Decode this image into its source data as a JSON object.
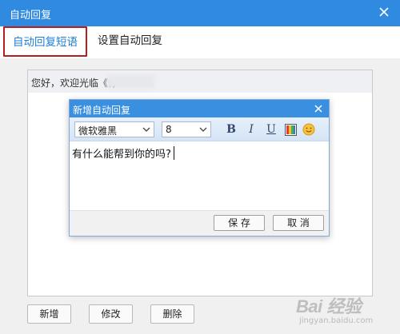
{
  "window": {
    "title": "自动回复"
  },
  "tabs": [
    {
      "label": "自动回复短语",
      "active": true
    },
    {
      "label": "设置自动回复",
      "active": false
    }
  ],
  "list": {
    "items": [
      {
        "text": "您好，欢迎光临《你"
      }
    ]
  },
  "buttons": {
    "add": "新增",
    "edit": "修改",
    "delete": "删除"
  },
  "dialog": {
    "title": "新增自动回复",
    "font_value": "微软雅黑",
    "size_value": "8",
    "bold": "B",
    "italic": "I",
    "underline": "U",
    "text": "有什么能帮到你的吗?",
    "save": "保 存",
    "cancel": "取 消"
  },
  "watermark": {
    "logo": "Bai 经验",
    "sub": "jingyan.baidu.com"
  },
  "colors": {
    "titlebar": "#2f8ae0",
    "dialog_titlebar": "#3a90e0",
    "active_tab": "#1f7fd8",
    "highlight_border": "#b51f1f"
  }
}
